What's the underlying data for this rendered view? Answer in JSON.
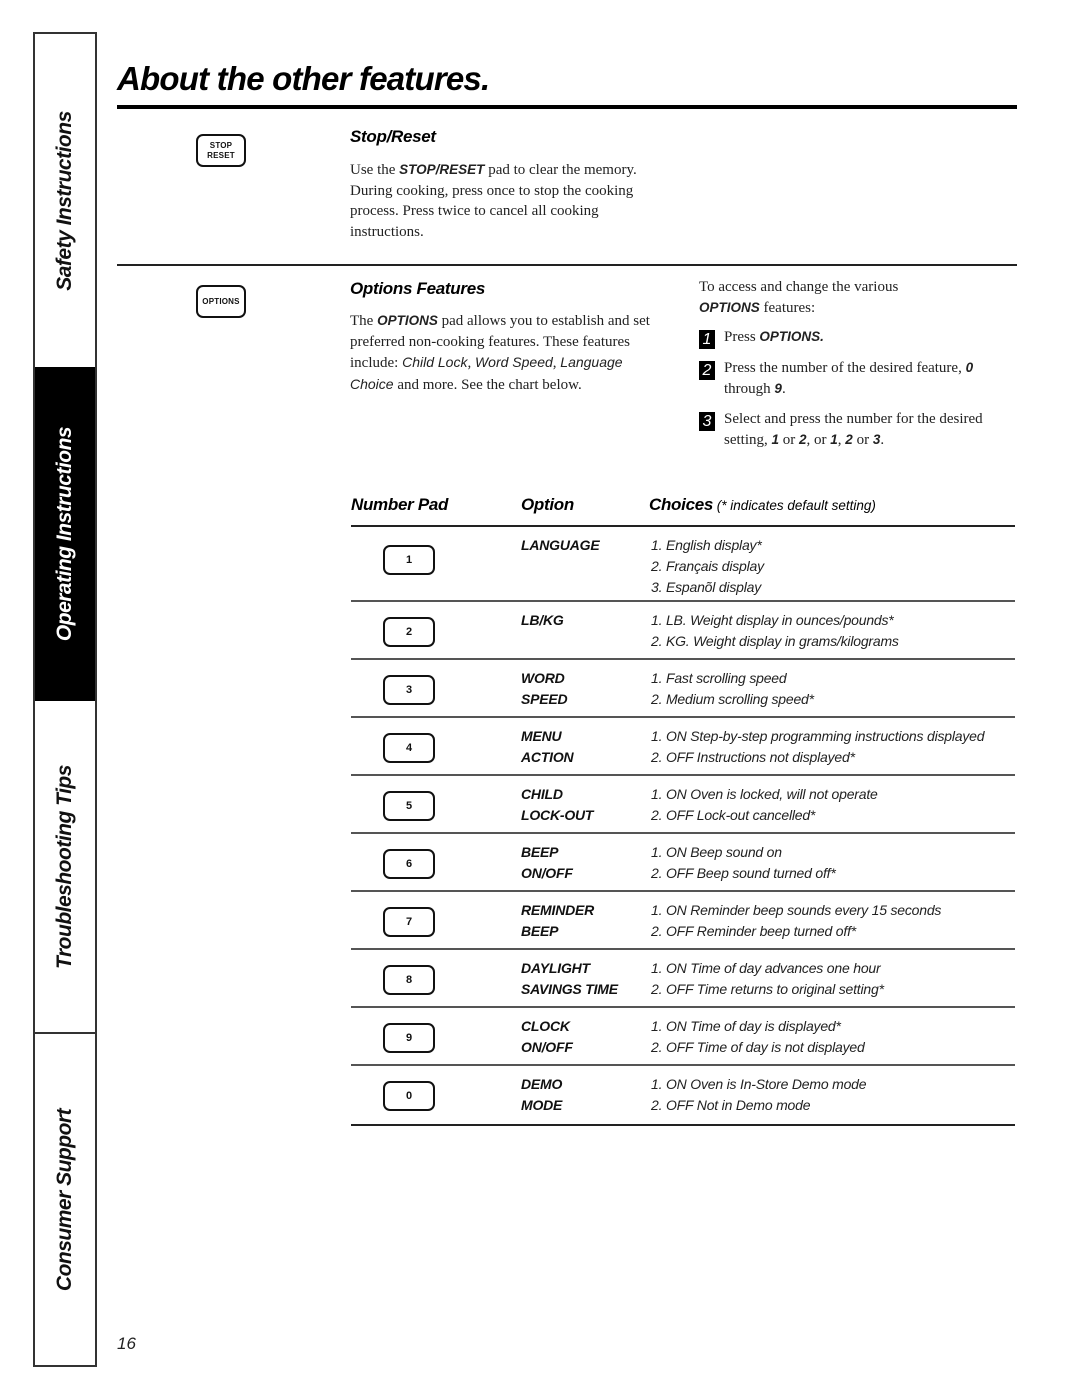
{
  "sidebar": {
    "tabs": [
      {
        "label": "Safety Instructions",
        "active": false
      },
      {
        "label": "Operating Instructions",
        "active": true
      },
      {
        "label": "Troubleshooting Tips",
        "active": false
      },
      {
        "label": "Consumer Support",
        "active": false
      }
    ]
  },
  "page": {
    "title": "About the other features.",
    "number": "16"
  },
  "stop_reset": {
    "pad_label_line1": "STOP",
    "pad_label_line2": "RESET",
    "heading": "Stop/Reset",
    "text_prefix": "Use the ",
    "keyword": "STOP/RESET",
    "text_suffix": " pad to clear the memory. During cooking, press once to stop the cooking process. Press twice to cancel all cooking instructions."
  },
  "options": {
    "pad_label": "OPTIONS",
    "heading": "Options Features",
    "text_1": "The ",
    "keyword": "OPTIONS",
    "text_2": " pad allows you to establish and set preferred non-cooking features. These features include: ",
    "feature_1": "Child Lock",
    "sep_1": ", ",
    "feature_2": "Word Speed",
    "sep_2": ", ",
    "feature_3": "Language Choice",
    "text_3": " and more. See the chart below.",
    "access_intro": "To access and change the various",
    "access_keyword": "OPTIONS",
    "access_suffix": " features:",
    "steps": [
      {
        "num": "1",
        "pre": "Press ",
        "kw": "OPTIONS.",
        "post": ""
      },
      {
        "num": "2",
        "pre": "Press the number of the desired feature, ",
        "kw": "0",
        "mid": " through ",
        "kw2": "9",
        "post": "."
      },
      {
        "num": "3",
        "pre": "Select and press the number for the desired setting, ",
        "a": "1",
        "b": " or ",
        "c": "2",
        "d": ", or ",
        "e": "1",
        "f": ", ",
        "g": "2",
        "h": " or ",
        "i": "3",
        "post": "."
      }
    ]
  },
  "table": {
    "headers": {
      "number_pad": "Number Pad",
      "option": "Option",
      "choices": "Choices",
      "choices_note": " (* indicates default setting)"
    },
    "rows": [
      {
        "pad": "1",
        "option": [
          "LANGUAGE"
        ],
        "choices": [
          "1. English display*",
          "2. Français display",
          "3. Espanõl display"
        ]
      },
      {
        "pad": "2",
        "option": [
          "LB/KG"
        ],
        "choices": [
          "1. LB. Weight display in ounces/pounds*",
          "2. KG. Weight display in grams/kilograms"
        ]
      },
      {
        "pad": "3",
        "option": [
          "WORD",
          "SPEED"
        ],
        "choices": [
          "1. Fast scrolling speed",
          "2. Medium scrolling speed*"
        ]
      },
      {
        "pad": "4",
        "option": [
          "MENU",
          "ACTION"
        ],
        "choices": [
          "1. ON Step-by-step programming instructions displayed",
          "2. OFF Instructions not displayed*"
        ]
      },
      {
        "pad": "5",
        "option": [
          "CHILD",
          "LOCK-OUT"
        ],
        "choices": [
          "1. ON Oven is locked, will not operate",
          "2. OFF Lock-out cancelled*"
        ]
      },
      {
        "pad": "6",
        "option": [
          "BEEP",
          "ON/OFF"
        ],
        "choices": [
          "1. ON Beep sound on",
          "2. OFF Beep sound turned off*"
        ]
      },
      {
        "pad": "7",
        "option": [
          "REMINDER",
          "BEEP"
        ],
        "choices": [
          "1. ON Reminder beep sounds every 15 seconds",
          "2. OFF Reminder beep turned off*"
        ]
      },
      {
        "pad": "8",
        "option": [
          "DAYLIGHT",
          "SAVINGS TIME"
        ],
        "choices": [
          "1. ON Time of day advances one hour",
          "2. OFF Time returns to original setting*"
        ]
      },
      {
        "pad": "9",
        "option": [
          "CLOCK",
          "ON/OFF"
        ],
        "choices": [
          "1. ON Time of day is displayed*",
          "2. OFF Time of day is not displayed"
        ]
      },
      {
        "pad": "0",
        "option": [
          "DEMO",
          "MODE"
        ],
        "choices": [
          "1. ON Oven is In-Store Demo mode",
          "2. OFF Not in Demo mode"
        ]
      }
    ]
  }
}
